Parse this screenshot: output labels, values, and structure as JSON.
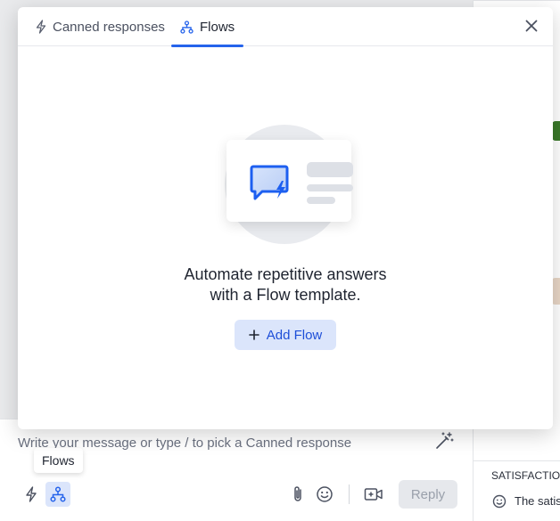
{
  "modal": {
    "tabs": [
      {
        "label": "Canned responses",
        "icon": "lightning-icon",
        "active": false
      },
      {
        "label": "Flows",
        "icon": "flow-icon",
        "active": true
      }
    ],
    "empty_state": {
      "title_line1": "Automate repetitive answers",
      "title_line2": "with a Flow template."
    },
    "add_flow_label": "Add Flow"
  },
  "composer": {
    "placeholder": "Write your message or type / to pick a Canned response",
    "tooltip": "Flows",
    "reply_label": "Reply"
  },
  "right_panel": {
    "heading": "SATISFACTION",
    "satisfaction_text": "The satis"
  },
  "colors": {
    "accent": "#2563eb",
    "accent_light": "#dbe5fb"
  }
}
